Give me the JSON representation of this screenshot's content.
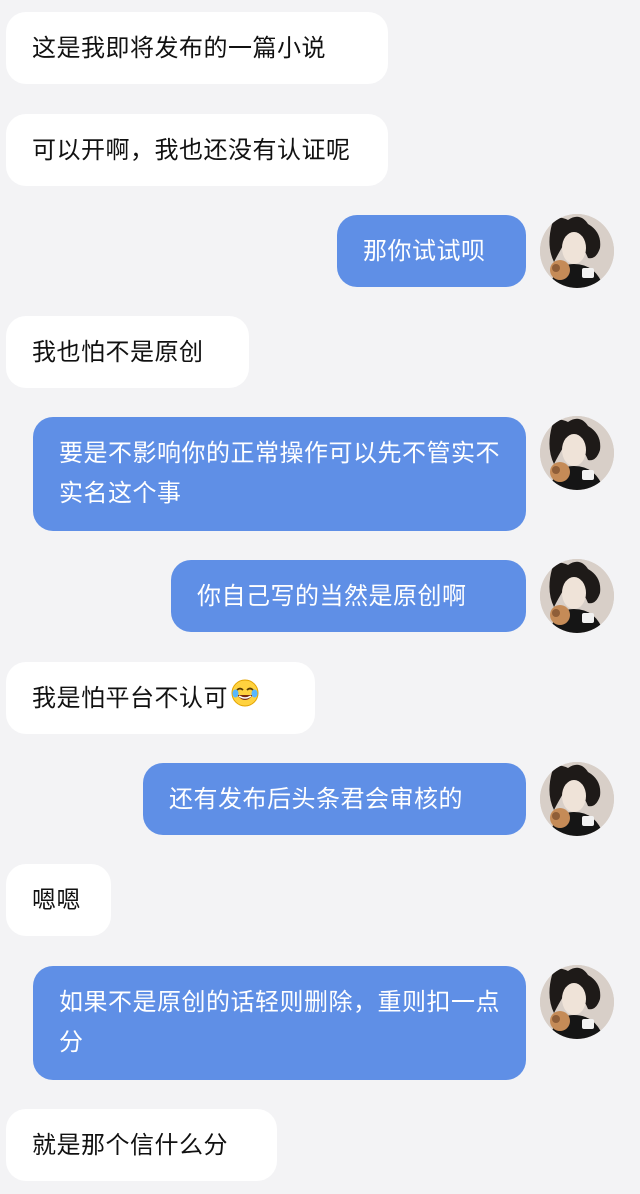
{
  "messages": [
    {
      "side": "left",
      "text": "这是我即将发布的一篇小说"
    },
    {
      "side": "left",
      "text": "可以开啊，我也还没有认证呢"
    },
    {
      "side": "right",
      "text": "那你试试呗"
    },
    {
      "side": "left",
      "text": "我也怕不是原创"
    },
    {
      "side": "right",
      "text": "要是不影响你的正常操作可以先不管实不实名这个事"
    },
    {
      "side": "right",
      "text": "你自己写的当然是原创啊"
    },
    {
      "side": "left",
      "text": "我是怕平台不认可",
      "emoji": "face-with-tears-of-joy-emoji"
    },
    {
      "side": "right",
      "text": "还有发布后头条君会审核的"
    },
    {
      "side": "left",
      "text": "嗯嗯"
    },
    {
      "side": "right",
      "text": "如果不是原创的话轻则删除，重则扣一点分"
    },
    {
      "side": "left",
      "text": "就是那个信什么分"
    }
  ],
  "colors": {
    "background": "#f3f3f5",
    "incoming_bubble": "#ffffff",
    "outgoing_bubble": "#5f8fe6",
    "outgoing_text": "#ffffff",
    "incoming_text": "#111111"
  },
  "avatar_icon": "user-avatar-photo"
}
